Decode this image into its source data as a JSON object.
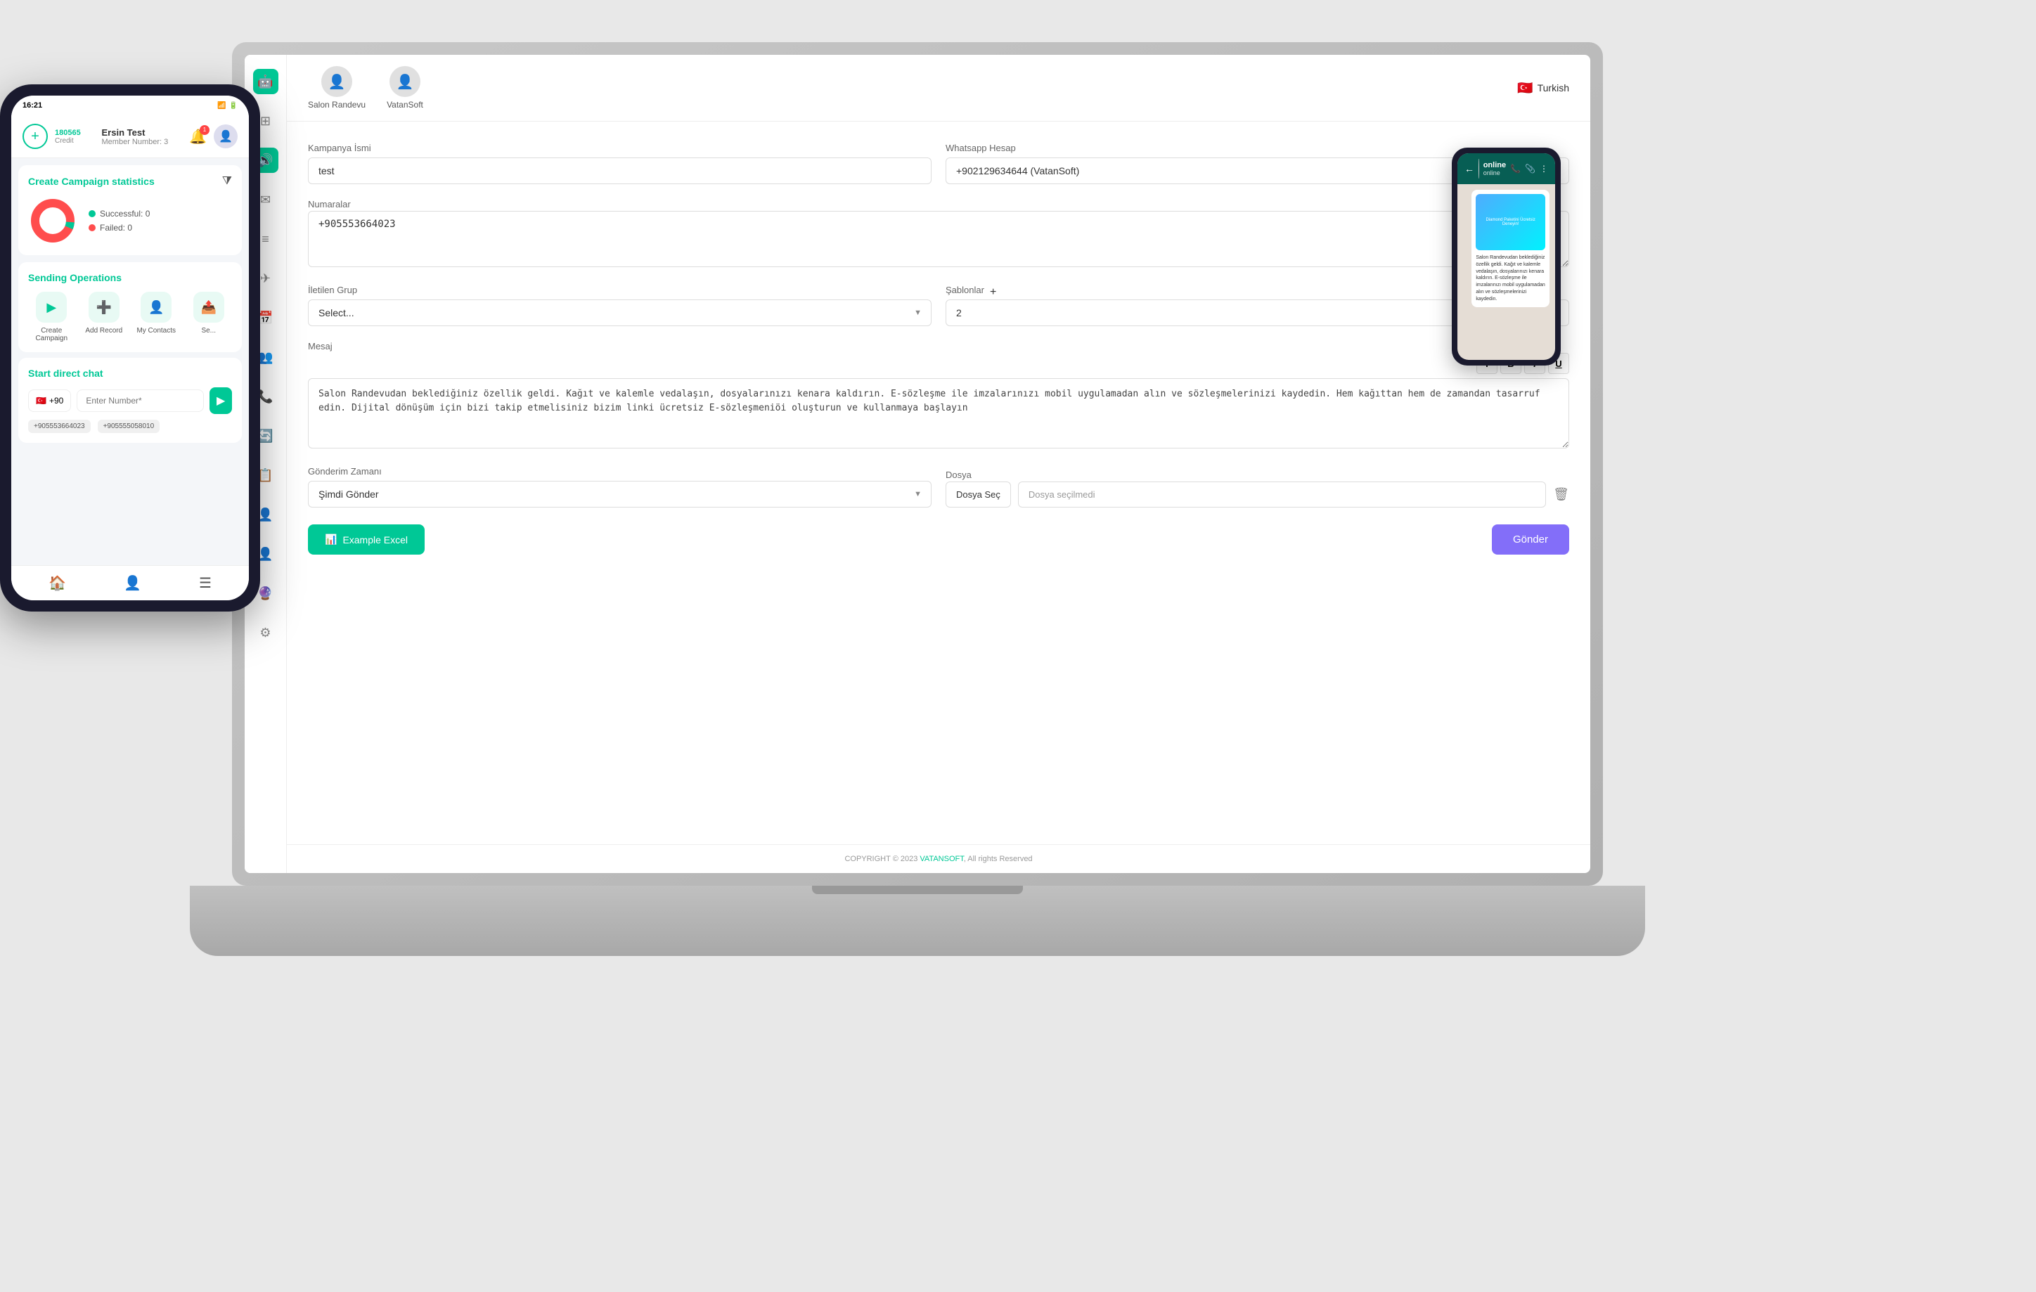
{
  "phone": {
    "status_time": "16:21",
    "status_icons": "📶",
    "credit_amount": "180565",
    "credit_label": "Credit",
    "user_name": "Ersin Test",
    "member_text": "Member Number: 3",
    "bell_count": "1",
    "stats_title": "Create Campaign statistics",
    "stats_successful": "Successful: 0",
    "stats_failed": "Failed: 0",
    "sending_ops_title": "Sending Operations",
    "ops": [
      {
        "icon": "▶",
        "label": "Create\nCampaign"
      },
      {
        "icon": "➕",
        "label": "Add Record"
      },
      {
        "icon": "👤",
        "label": "My Contacts"
      },
      {
        "icon": "📤",
        "label": "Se\nMess..."
      }
    ],
    "direct_chat_title": "Start direct chat",
    "flag": "🇹🇷",
    "country_code": "+90",
    "number_placeholder": "Enter Number*",
    "recent_numbers": [
      "+905553664023",
      "+905555058010"
    ],
    "bottom_nav": [
      "🏠",
      "👤",
      "☰"
    ]
  },
  "laptop": {
    "accounts": [
      {
        "name": "Salon Randevu"
      },
      {
        "name": "VatanSoft"
      }
    ],
    "language": "Turkish",
    "flag": "🇹🇷",
    "form": {
      "kampanya_ismi_label": "Kampanya İsmi",
      "kampanya_ismi_value": "test",
      "whatsapp_hesap_label": "Whatsapp Hesap",
      "whatsapp_hesap_value": "+902129634644 (VatanSoft)",
      "numaralar_label": "Numaralar",
      "numaralar_value": "+905553664023",
      "iletilen_grup_label": "İletilen Grup",
      "iletilen_grup_placeholder": "Select...",
      "sablonlar_label": "Şablonlar",
      "sablonlar_value": "2",
      "mesaj_label": "Mesaj",
      "mesaj_text": "Salon Randevudan beklediğiniz özellik geldi. Kağıt ve kalemle vedalaşın, dosyalarınızı kenara kaldırın. E-sözleşme ile imzalarınızı mobil uygulamadan alın ve sözleşmelerinizi kaydedin. Hem kağıttan hem de zamandan tasarruf edin. Dijital dönüşüm için bizi takip etmelisiniz bizim linki ücretsiz E-sözleşmeniöi oluşturun ve kullanmaya başlayın",
      "gonderim_zamani_label": "Gönderim Zamanı",
      "gonderim_zamani_value": "Şimdi Gönder",
      "dosya_label": "Dosya",
      "dosya_select": "Dosya Seç",
      "dosya_placeholder": "Dosya seçilmedi",
      "gondar_label": "Gönder",
      "example_excel_label": "Example Excel",
      "toolbar": [
        "T",
        "B",
        "I",
        "U"
      ]
    },
    "footer": "COPYRIGHT © 2023 VATANSOFT, All rights Reserved",
    "footer_brand": "VATANSOFT"
  },
  "preview": {
    "status": "online",
    "msg_text": "Salon Randevudan beklediğiniz özellik geldi. Kağıt ve kalemle vedalaşın, dosyalarınızı kenara kaldırın. E-sözleşme ile imzalarınızı mobil uygulamadan alın ve sözleşmelerinizi kaydedin."
  },
  "sidebar": {
    "icons": [
      "🤖",
      "⊞",
      "🔊",
      "✉",
      "≡",
      "✈",
      "📅",
      "👥",
      "📞",
      "🔄",
      "📋",
      "👤",
      "👤",
      "🔮",
      "⚙"
    ]
  }
}
